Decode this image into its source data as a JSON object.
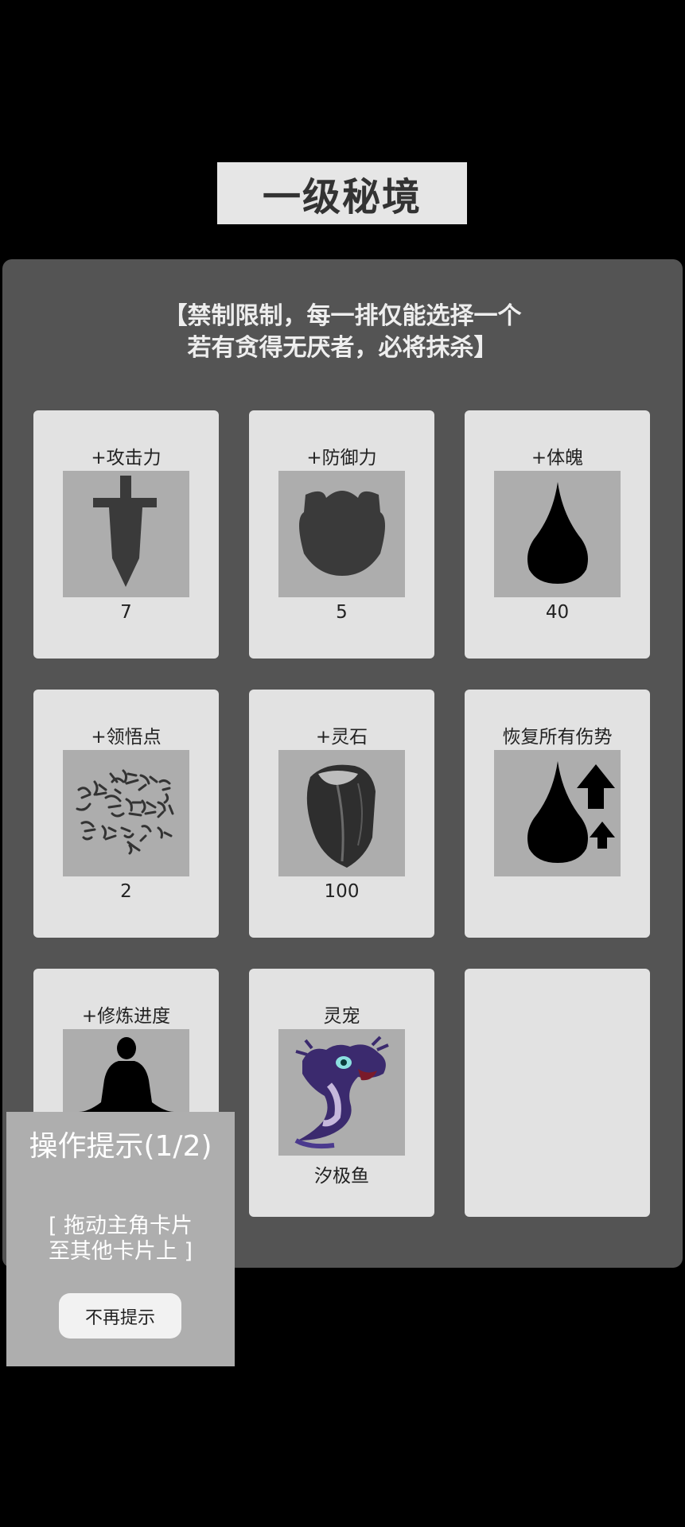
{
  "header": {
    "title": "一级秘境"
  },
  "notice": {
    "line1": "【禁制限制，每一排仅能选择一个",
    "line2": "若有贪得无厌者，必将抹杀】"
  },
  "cards": [
    {
      "label": "+攻击力",
      "value": "7",
      "icon": "sword-icon"
    },
    {
      "label": "+防御力",
      "value": "5",
      "icon": "shield-icon"
    },
    {
      "label": "+体魄",
      "value": "40",
      "icon": "blood-drop-icon"
    },
    {
      "label": "+领悟点",
      "value": "2",
      "icon": "calligraphy-icon"
    },
    {
      "label": "+灵石",
      "value": "100",
      "icon": "spirit-stone-icon"
    },
    {
      "label": "恢复所有伤势",
      "value": "",
      "icon": "heal-drop-arrows-icon"
    },
    {
      "label": "+修炼进度",
      "value": "",
      "icon": "meditation-icon"
    },
    {
      "label": "灵宠",
      "value": "汐极鱼",
      "icon": "dragon-fish-pet-icon"
    },
    {
      "label": "",
      "value": "",
      "icon": ""
    }
  ],
  "tip": {
    "title": "操作提示(1/2)",
    "line1": "[ 拖动主角卡片",
    "line2": "至其他卡片上 ]",
    "button": "不再提示"
  },
  "colors": {
    "background": "#000000",
    "panel": "#545454",
    "card": "#e2e2e2",
    "tip_panel": "#aeaeae"
  }
}
